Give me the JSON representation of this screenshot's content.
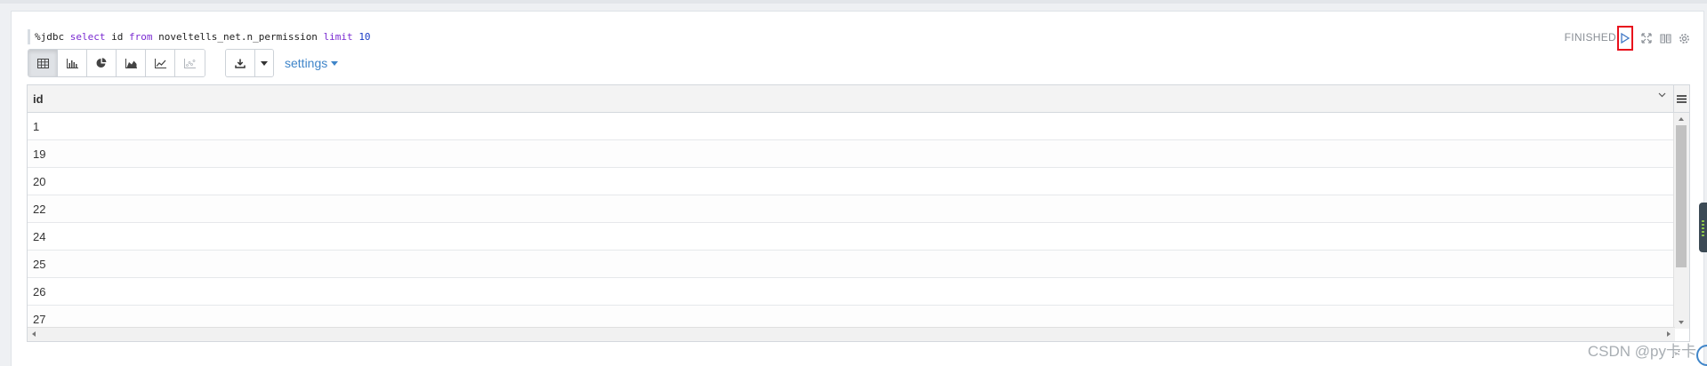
{
  "paragraph": {
    "code": {
      "interpreter": "%jdbc",
      "kw_select": "select",
      "col": "id",
      "kw_from": "from",
      "table": "noveltells_net.n_permission",
      "kw_limit": "limit",
      "limit_value": "10"
    },
    "status": "FINISHED",
    "header_icons": [
      "play-icon",
      "expand-icon",
      "book-icon",
      "gear-icon"
    ]
  },
  "toolbar": {
    "viz_buttons": [
      "table-icon",
      "bar-chart-icon",
      "pie-chart-icon",
      "area-chart-icon",
      "line-chart-icon",
      "scatter-chart-icon"
    ],
    "active_viz": "table-icon",
    "download_icon": "download-icon",
    "settings_label": "settings"
  },
  "table": {
    "column": "id",
    "rows": [
      "1",
      "19",
      "20",
      "22",
      "24",
      "25",
      "26",
      "27"
    ]
  },
  "watermark": "CSDN @py卡卡",
  "colors": {
    "accent": "#3f85c9",
    "run_highlight": "#e8101c",
    "keyword": "#7a2bd1",
    "number": "#1a3cc7"
  }
}
